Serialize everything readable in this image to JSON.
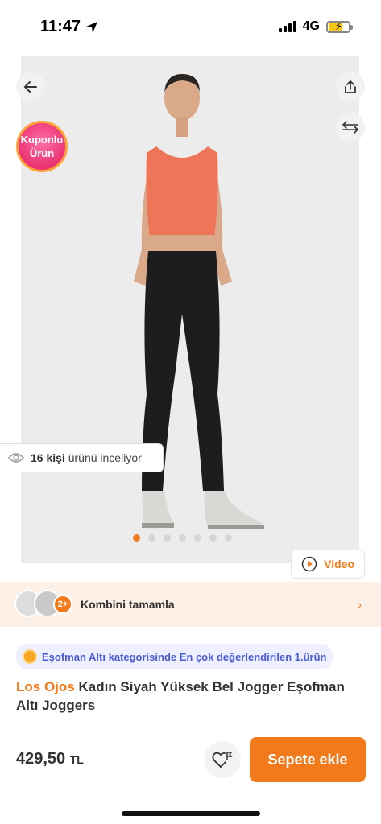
{
  "status_bar": {
    "time": "11:47",
    "network": "4G"
  },
  "product_image": {
    "coupon_badge": {
      "line1": "Kuponlu",
      "line2": "Ürün"
    },
    "viewers": {
      "count": "16 kişi",
      "text": "ürünü inceliyor"
    },
    "carousel": {
      "total": 7,
      "active": 0
    },
    "video_label": "Video"
  },
  "combine": {
    "extra_count": "2+",
    "label": "Kombini tamamla"
  },
  "category_highlight": {
    "text": "Eşofman Altı kategorisinde En çok değerlendirilen 1.ürün"
  },
  "product": {
    "brand": "Los Ojos",
    "name": "Kadın Siyah Yüksek Bel Jogger Eşofman Altı Joggers"
  },
  "purchase": {
    "price": "429,50",
    "currency": "TL",
    "cart_label": "Sepete ekle"
  },
  "colors": {
    "accent": "#f27a1a",
    "category_text": "#4a5bd6"
  }
}
